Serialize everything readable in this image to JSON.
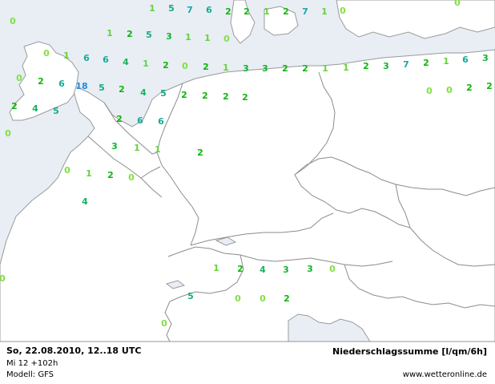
{
  "colors": {
    "sea": "#e8eef4",
    "land": "#ffffff",
    "border": "#8c8c8c",
    "coast": "#9a9a9a",
    "levels": {
      "0": "#80e040",
      "1": "#64d23c",
      "2": "#12b40e",
      "3": "#10b42c",
      "4": "#14b45a",
      "5": "#16aa82",
      "6": "#16aa96",
      "7": "#1aa6a8",
      "18": "#1c8ce0"
    }
  },
  "footer": {
    "date": "So, 22.08.2010, 12..18 UTC",
    "run": "Mi 12 +102h",
    "model": "Modell: GFS",
    "title": "Niederschlagssumme [l/qm/6h]",
    "source": "www.wetteronline.de"
  },
  "values": [
    {
      "v": "1"
    },
    {
      "v": "5"
    },
    {
      "v": "7"
    },
    {
      "v": "6"
    },
    {
      "v": "2"
    },
    {
      "v": "2"
    },
    {
      "v": "1"
    },
    {
      "v": "2"
    },
    {
      "v": "7"
    },
    {
      "v": "1"
    },
    {
      "v": "0"
    },
    {
      "v": "0"
    },
    {
      "v": "0"
    },
    {
      "v": "1"
    },
    {
      "v": "2"
    },
    {
      "v": "5"
    },
    {
      "v": "3"
    },
    {
      "v": "1"
    },
    {
      "v": "1"
    },
    {
      "v": "0"
    },
    {
      "v": "0"
    },
    {
      "v": "1"
    },
    {
      "v": "6"
    },
    {
      "v": "6"
    },
    {
      "v": "4"
    },
    {
      "v": "1"
    },
    {
      "v": "2"
    },
    {
      "v": "0"
    },
    {
      "v": "2"
    },
    {
      "v": "1"
    },
    {
      "v": "3"
    },
    {
      "v": "3"
    },
    {
      "v": "2"
    },
    {
      "v": "2"
    },
    {
      "v": "1"
    },
    {
      "v": "1"
    },
    {
      "v": "2"
    },
    {
      "v": "3"
    },
    {
      "v": "7"
    },
    {
      "v": "2"
    },
    {
      "v": "1"
    },
    {
      "v": "6"
    },
    {
      "v": "3"
    },
    {
      "v": "0"
    },
    {
      "v": "2"
    },
    {
      "v": "6"
    },
    {
      "v": "18"
    },
    {
      "v": "5"
    },
    {
      "v": "2"
    },
    {
      "v": "4"
    },
    {
      "v": "5"
    },
    {
      "v": "2"
    },
    {
      "v": "2"
    },
    {
      "v": "2"
    },
    {
      "v": "2"
    },
    {
      "v": "0"
    },
    {
      "v": "0"
    },
    {
      "v": "2"
    },
    {
      "v": "2"
    },
    {
      "v": "2"
    },
    {
      "v": "4"
    },
    {
      "v": "5"
    },
    {
      "v": "2"
    },
    {
      "v": "6"
    },
    {
      "v": "6"
    },
    {
      "v": "0"
    },
    {
      "v": "3"
    },
    {
      "v": "1"
    },
    {
      "v": "1"
    },
    {
      "v": "2"
    },
    {
      "v": "0"
    },
    {
      "v": "1"
    },
    {
      "v": "2"
    },
    {
      "v": "0"
    },
    {
      "v": "4"
    },
    {
      "v": "1"
    },
    {
      "v": "2"
    },
    {
      "v": "4"
    },
    {
      "v": "3"
    },
    {
      "v": "3"
    },
    {
      "v": "0"
    },
    {
      "v": "0"
    },
    {
      "v": "5"
    },
    {
      "v": "0"
    },
    {
      "v": "0"
    },
    {
      "v": "2"
    },
    {
      "v": "0"
    }
  ]
}
